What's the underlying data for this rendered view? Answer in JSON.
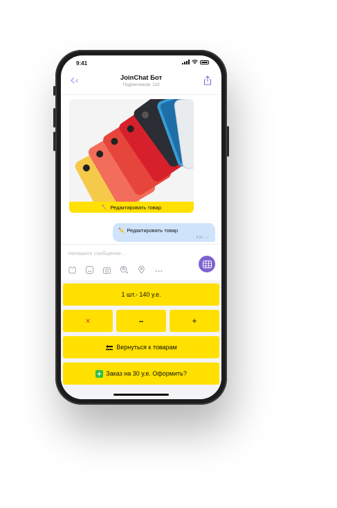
{
  "status": {
    "time": "9:41"
  },
  "header": {
    "back_count": "4",
    "title": "JoinChat Бот",
    "subtitle": "Подписчиков: 110"
  },
  "chat": {
    "photo_button_label": "Редактировать товар",
    "bubble_text": "Редактировать товар",
    "bubble_time": "8:55"
  },
  "composer": {
    "placeholder": "Напишите сообщение..."
  },
  "keyboard": {
    "quantity_label": "1 шт.- 140 у.е.",
    "remove_label": "×",
    "minus_label": "–",
    "plus_label": "+",
    "back_label": "Вернуться к товарам",
    "order_label": "Заказ на 30 у.е. Оформить?"
  },
  "icons": [
    "sticker-icon",
    "emoji-icon",
    "camera-icon",
    "contact-icon",
    "location-icon",
    "more-icon",
    "keyboard-grid-icon",
    "share-icon",
    "back-chevron-icon",
    "pencil-icon",
    "back-arrow-icon",
    "checkmark-icon"
  ],
  "colors": {
    "keyboard_button": "#ffe000",
    "bubble": "#cfe4fb",
    "accent": "#7b64cf",
    "remove": "#e03030"
  }
}
